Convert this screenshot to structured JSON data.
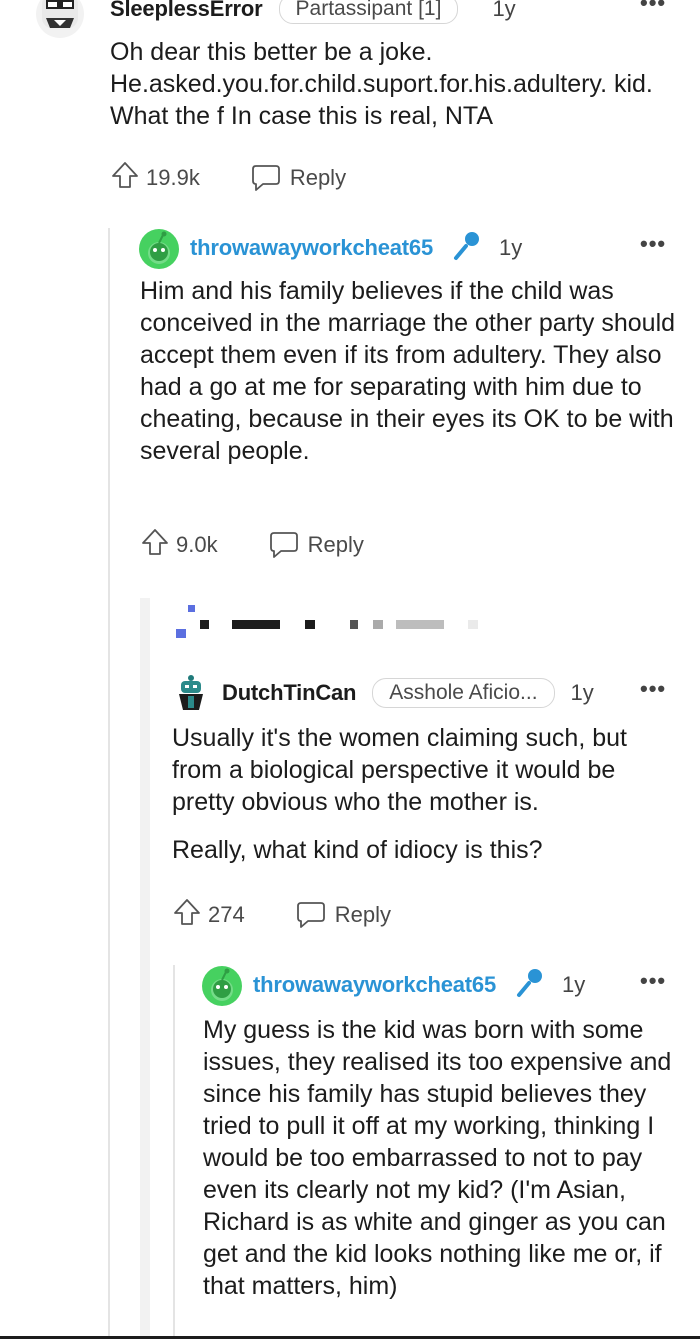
{
  "comments": [
    {
      "username": "SleeplessError",
      "flair": "Partassipant [1]",
      "age": "1y",
      "paragraphs": [
        "Oh dear this better be a joke.\nHe.asked.you.for.child.suport.for.his.adultery. kid. What the f In case this is real, NTA"
      ],
      "votes": "19.9k",
      "reply_label": "Reply"
    },
    {
      "username": "throwawayworkcheat65",
      "is_op": true,
      "age": "1y",
      "paragraphs": [
        "Him and his family believes if the child was conceived in the marriage the other party should accept them even if its from adultery. They also had a go at me for separating with him due to cheating, because in their eyes its OK to be with several people."
      ],
      "votes": "9.0k",
      "reply_label": "Reply"
    },
    {
      "username": "DutchTinCan",
      "flair": "Asshole Aficio...",
      "age": "1y",
      "paragraphs": [
        "Usually it's the women claiming such, but from a biological perspective it would be pretty obvious who the mother is.",
        "Really, what kind of idiocy is this?"
      ],
      "votes": "274",
      "reply_label": "Reply"
    },
    {
      "username": "throwawayworkcheat65",
      "is_op": true,
      "age": "1y",
      "paragraphs": [
        "My guess is the kid was born with some issues, they realised its too expensive and since his family has stupid believes they tried to pull it off at my working, thinking I would be too embarrassed to not to pay even its clearly not my kid? (I'm Asian, Richard is as white and ginger as you can get and the kid looks nothing like me or, if that matters, him)"
      ]
    }
  ],
  "colors": {
    "op_username": "#2a93d5",
    "text": "#1c1c1c",
    "meta": "#4a4a4a",
    "thread_line": "#e4e4e4",
    "avatar_green": "#46d160"
  },
  "icons": [
    "upvote-arrow-icon",
    "reply-bubble-icon",
    "microphone-icon",
    "more-options-icon"
  ]
}
